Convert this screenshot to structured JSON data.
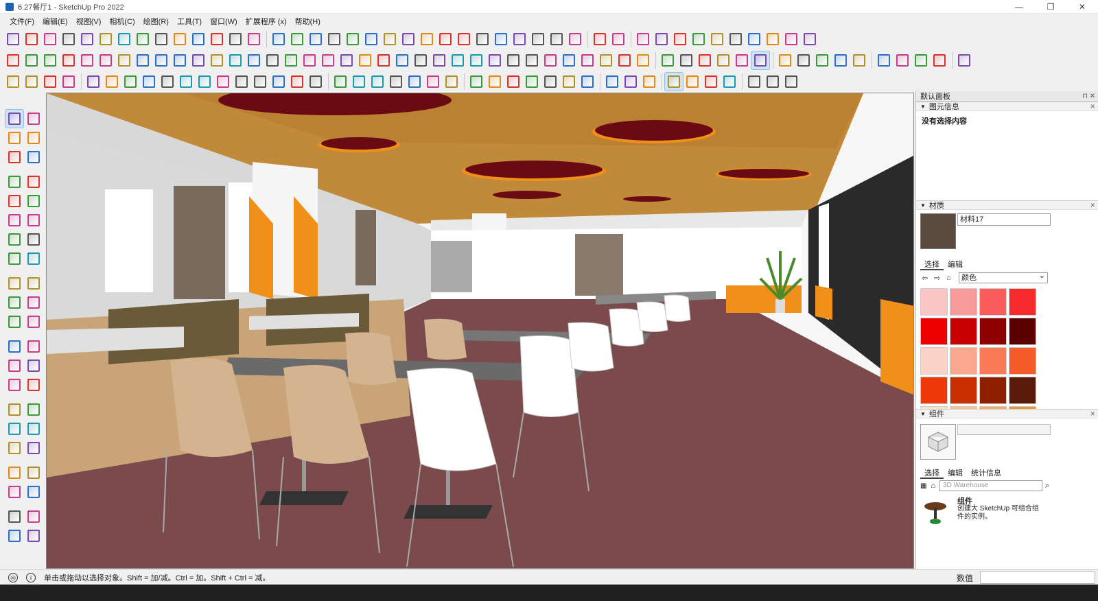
{
  "window": {
    "title": "6.27餐厅1 - SketchUp Pro 2022",
    "min_icon": "—",
    "max_icon": "❐",
    "close_icon": "✕"
  },
  "menus": [
    "文件(F)",
    "编辑(E)",
    "视图(V)",
    "相机(C)",
    "绘图(R)",
    "工具(T)",
    "窗口(W)",
    "扩展程序 (x)",
    "帮助(H)"
  ],
  "toolbar_icons": {
    "row1": [
      "select-icon",
      "lasso-icon",
      "orbit-icon",
      "gear-icon",
      "shield-icon",
      "shield-red-icon",
      "cone-icon",
      "tree-icon",
      "tag-icon",
      "box-grid-icon",
      "section-icon",
      "3d-text-icon",
      "3d-box-icon",
      "face-icon",
      "paint-bucket-icon",
      "eyedropper-icon",
      "swap-icon",
      "component-a-icon",
      "component-b-icon",
      "component-c-icon",
      "component-d-icon",
      "hatch-icon",
      "image-icon",
      "layers-icon",
      "color-cube-icon",
      "grid-icon",
      "pattern-icon",
      "window-icon",
      "text-box-icon",
      "group-icon",
      "frame-icon",
      "line-tool-icon",
      "dimension-icon",
      "magnet-icon",
      "scissors-icon",
      "wand-icon",
      "rotate-icon",
      "move-icon",
      "knife-icon",
      "hook-icon",
      "box-orange-icon",
      "select-red-icon",
      "select-orange-icon"
    ],
    "row2": [
      "color-cube-icon",
      "brush-icon",
      "arrow-tool-icon",
      "curve-icon",
      "circle-icon",
      "cube-red-icon",
      "cube-red-b-icon",
      "cube-grid-icon",
      "undo-icon",
      "spiral-icon",
      "flow-icon",
      "corner-icon",
      "box-yellow-icon",
      "cube-icon",
      "cube-b-icon",
      "cube-stack-icon",
      "frame-icon",
      "axis-x-icon",
      "axis-y-icon",
      "axis-z-icon",
      "axis-r-icon",
      "axis-v-icon",
      "sphere-icon",
      "half-sphere-icon",
      "torus-icon",
      "rings-icon",
      "rings-b-icon",
      "trefoil-icon",
      "grid-blue-icon",
      "grid-red-icon",
      "mountain-icon",
      "mountain-b-icon",
      "sheet-icon",
      "s-curve-icon",
      "s-curve-red-icon",
      "circle-purple-icon",
      "target-icon",
      "camera-icon",
      "camera-b-icon",
      "timer-icon",
      "flower-icon",
      "house-icon",
      "house-b-icon",
      "house-c-icon",
      "house-d-icon",
      "house-e-icon",
      "dot-icon",
      "cone-gray-icon",
      "dash-icon",
      "rectangle-icon",
      "eye-slash-icon"
    ],
    "row3": [
      "stairs-icon",
      "railing-icon",
      "wall-icon",
      "bars-icon",
      "split-icon",
      "line-split-icon",
      "stairs-b-icon",
      "stairs-c-icon",
      "arch-icon",
      "loop-icon",
      "pipe-icon",
      "board-icon",
      "needle-icon",
      "frames-icon",
      "frames-b-icon",
      "tool-set-icon",
      "block-icon",
      "arc-icon",
      "chain-icon",
      "wave-icon",
      "spiral-b-icon",
      "angle-icon",
      "columns-icon",
      "pillars-icon",
      "triangle-icon",
      "dots-icon",
      "bookmark-icon",
      "pen-icon",
      "brush-b-icon",
      "round-icon",
      "timer-b-icon",
      "table-icon",
      "ring-char-icon",
      "model-char-icon",
      "cloud-icon",
      "cloud-search-icon",
      "cloud-b-icon",
      "cloud-c-icon",
      "resize-icon",
      "gear-color-icon",
      "refresh-icon"
    ]
  },
  "left_tools": [
    "select-icon",
    "orbit-icon",
    "paint-icon",
    "eraser-icon",
    "component-icon",
    "tape-icon",
    "pencil-icon",
    "curve-icon",
    "rectangle-icon",
    "rotated-rect-icon",
    "circle-icon",
    "polygon-icon",
    "arc-icon",
    "arc-b-icon",
    "arc-c-icon",
    "pie-icon",
    "move-icon",
    "push-pull-icon",
    "rotate-icon",
    "follow-me-icon",
    "scale-icon",
    "offset-icon",
    "tape-measure-icon",
    "dimension-icon",
    "protractor-icon",
    "text-icon",
    "axes-icon",
    "3d-text-icon",
    "orbit-b-icon",
    "pan-icon",
    "zoom-icon",
    "zoom-window-icon",
    "zoom-extents-icon",
    "previous-icon",
    "walk-icon",
    "look-icon",
    "footprints-icon",
    "section-plane-icon",
    "sandbox-icon",
    "sandbox-b-icon",
    "layers-b-icon",
    "sandbox-c-icon"
  ],
  "tray": {
    "title": "默认面板",
    "entity_info": {
      "header": "图元信息",
      "text": "没有选择内容"
    },
    "materials": {
      "header": "材质",
      "name": "材料17",
      "swatch_color": "#5a4a40",
      "tabs": [
        "选择",
        "编辑"
      ],
      "library": "颜色",
      "swatches": [
        "#fbc5c5",
        "#fb9a9a",
        "#fb5c5c",
        "#f52a2a",
        "#ee0000",
        "#c80000",
        "#8e0000",
        "#5a0000",
        "#fbd2c8",
        "#fba98e",
        "#fb7a56",
        "#f55a2a",
        "#ee3a0a",
        "#c83000",
        "#8e2000",
        "#5a1a08",
        "#fde0c8",
        "#fdc08e",
        "#fda85c",
        "#f5922a"
      ]
    },
    "components": {
      "header": "组件",
      "tabs": [
        "选择",
        "编辑",
        "统计信息"
      ],
      "search_placeholder": "3D Warehouse",
      "item": {
        "name": "组件",
        "desc": "创建大 SketchUp 可组合组件的实例。"
      }
    }
  },
  "status": {
    "text": "单击或拖动以选择对象。Shift = 加/减。Ctrl = 加。Shift + Ctrl = 减。",
    "measurements_label": "数值",
    "measurements_value": ""
  },
  "scene": {
    "ceiling_color": "#c08a3a",
    "floor_color": "#7a4a4c",
    "accent_orange": "#f0901a",
    "dome_color": "#6a0a12"
  }
}
